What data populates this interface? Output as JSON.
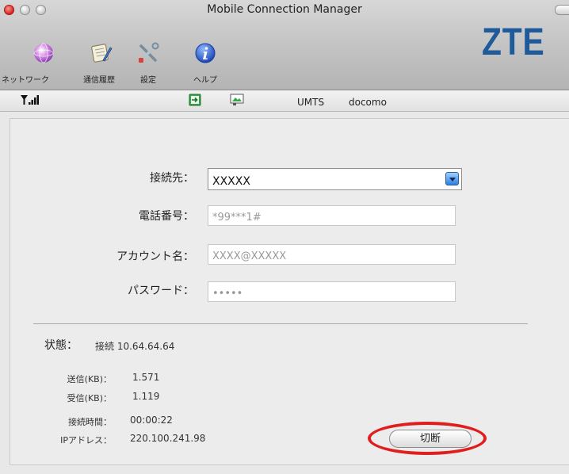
{
  "window": {
    "title": "Mobile Connection Manager",
    "logo": "ZTE"
  },
  "toolbar": {
    "items": [
      {
        "label": "ネットワーク",
        "icon": "globe-icon"
      },
      {
        "label": "通信履歴",
        "icon": "notepad-icon"
      },
      {
        "label": "設定",
        "icon": "tools-icon"
      },
      {
        "label": "ヘルプ",
        "icon": "info-icon"
      }
    ]
  },
  "status": {
    "network_type": "UMTS",
    "carrier": "docomo"
  },
  "form": {
    "connect_label": "接続先：",
    "connect_value": "XXXXX",
    "phone_label": "電話番号：",
    "phone_placeholder": "*99***1#",
    "account_label": "アカウント名：",
    "account_placeholder": "XXXX@XXXXX",
    "password_label": "パスワード：",
    "password_value": "•••••"
  },
  "connection": {
    "state_label": "状態：",
    "state_value": "接続 10.64.64.64",
    "sent_label": "送信(KB)：",
    "sent_value": "1.571",
    "recv_label": "受信(KB)：",
    "recv_value": "1.119",
    "time_label": "接続時間：",
    "time_value": "00:00:22",
    "ip_label": "IPアドレス：",
    "ip_value": "220.100.241.98",
    "disconnect_label": "切断"
  },
  "colors": {
    "logo": "#1f5a9a",
    "highlight_ring": "#e01e1e"
  }
}
